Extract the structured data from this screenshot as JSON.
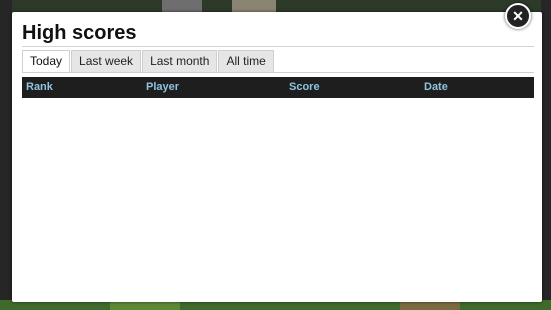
{
  "dialog": {
    "title": "High scores",
    "close_icon": "close-icon",
    "close_glyph": "✕"
  },
  "tabs": [
    {
      "label": "Today",
      "active": true
    },
    {
      "label": "Last week",
      "active": false
    },
    {
      "label": "Last month",
      "active": false
    },
    {
      "label": "All time",
      "active": false
    }
  ],
  "table": {
    "columns": [
      "Rank",
      "Player",
      "Score",
      "Date"
    ],
    "rows": []
  },
  "colors": {
    "header_bg": "#1e1e1e",
    "header_text": "#8fc4de",
    "dialog_bg": "#ffffff",
    "active_tab_bg": "#ffffff",
    "inactive_tab_bg": "#e6e6e6"
  }
}
